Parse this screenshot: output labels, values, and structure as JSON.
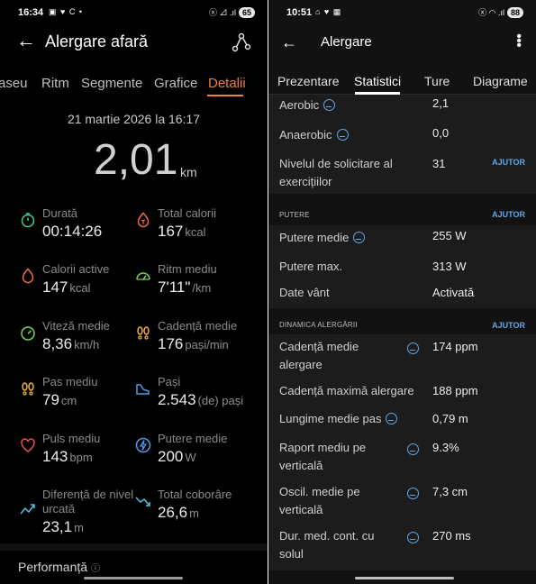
{
  "left": {
    "status": {
      "time": "16:34",
      "icons": "▣ ♥ C •",
      "signal": "ⓧ ⊿ .ıl",
      "battery": "65"
    },
    "title": "Alergare afară",
    "tabs": [
      "aseu",
      "Ritm",
      "Segmente",
      "Grafice",
      "Detalii"
    ],
    "date": "21 martie 2026 la 16:17",
    "distance": {
      "value": "2,01",
      "unit": "km"
    },
    "metrics": [
      {
        "label": "Durată",
        "value": "00:14:26",
        "unit": ""
      },
      {
        "label": "Total calorii",
        "value": "167",
        "unit": "kcal"
      },
      {
        "label": "Calorii active",
        "value": "147",
        "unit": "kcal"
      },
      {
        "label": "Ritm mediu",
        "value": "7'11\"",
        "unit": "/km"
      },
      {
        "label": "Viteză medie",
        "value": "8,36",
        "unit": "km/h"
      },
      {
        "label": "Cadență medie",
        "value": "176",
        "unit": "pași/min"
      },
      {
        "label": "Pas mediu",
        "value": "79",
        "unit": "cm"
      },
      {
        "label": "Pași",
        "value": "2.543",
        "unit": "(de) pași"
      },
      {
        "label": "Puls mediu",
        "value": "143",
        "unit": "bpm"
      },
      {
        "label": "Putere medie",
        "value": "200",
        "unit": "W"
      },
      {
        "label": "Diferență de nivel urcată",
        "value": "23,1",
        "unit": "m"
      },
      {
        "label": "Total coborâre",
        "value": "26,6",
        "unit": "m"
      }
    ],
    "performance": "Performanță",
    "colors": {
      "accent": "#f07f3c"
    }
  },
  "right": {
    "status": {
      "time": "10:51",
      "icons": "⌂ ♥ ▦",
      "signal": "ⓧ ◠ .ıl",
      "battery": "88"
    },
    "title": "Alergare",
    "tabs": [
      "Prezentare",
      "Statistici",
      "Ture",
      "Diagrame"
    ],
    "top_rows": [
      {
        "label": "Aerobic",
        "value": "2,1",
        "info": true
      },
      {
        "label": "Anaerobic",
        "value": "0,0",
        "info": true
      },
      {
        "label": "Nivelul de solicitare al exercițiilor",
        "value": "31",
        "info": false
      }
    ],
    "ajutor": "AJUTOR",
    "power_section": {
      "heading": "PUTERE",
      "rows": [
        {
          "label": "Putere medie",
          "value": "255 W",
          "info": true
        },
        {
          "label": "Putere max.",
          "value": "313 W",
          "info": false
        },
        {
          "label": "Date vânt",
          "value": "Activată",
          "info": false
        }
      ]
    },
    "dynamics_section": {
      "heading": "DINAMICA ALERGĂRII",
      "rows": [
        {
          "label": "Cadență medie alergare",
          "value": "174 ppm",
          "info": true
        },
        {
          "label": "Cadență maximă alergare",
          "value": "188 ppm",
          "info": false
        },
        {
          "label": "Lungime medie pas",
          "value": "0,79 m",
          "info": true
        },
        {
          "label": "Raport mediu pe verticală",
          "value": "9.3%",
          "info": true
        },
        {
          "label": "Oscil. medie pe verticală",
          "value": "7,3 cm",
          "info": true
        },
        {
          "label": "Dur. med. cont. cu solul",
          "value": "270 ms",
          "info": true
        }
      ]
    },
    "colors": {
      "link": "#5ea8e8"
    }
  }
}
